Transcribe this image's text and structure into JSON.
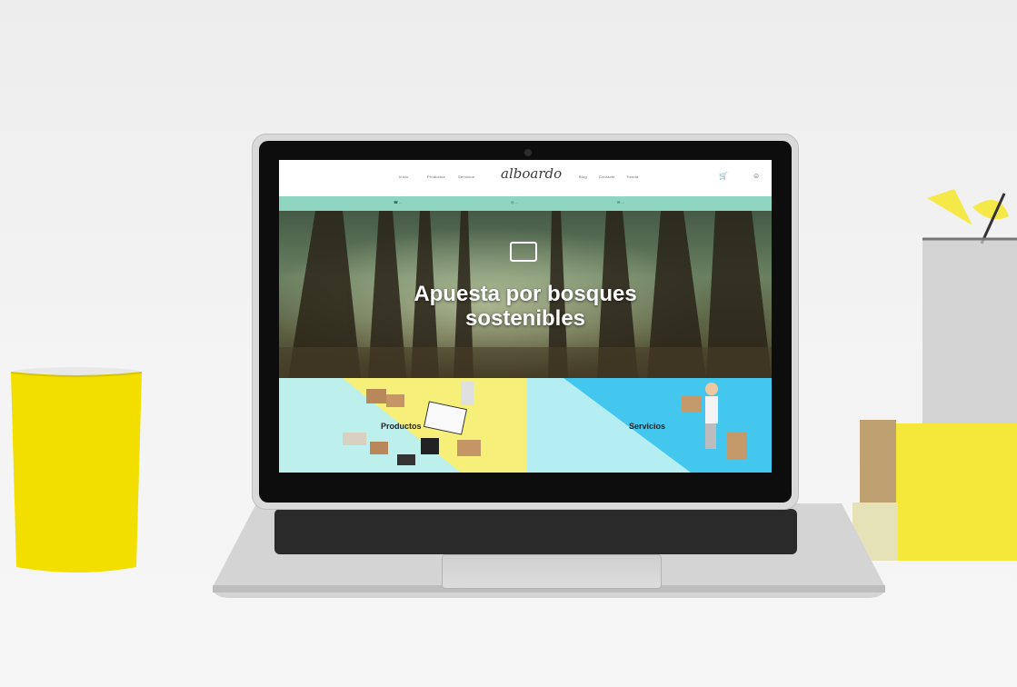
{
  "site": {
    "nav_left": [
      "Inicio",
      "Productos",
      "Servicios"
    ],
    "nav_right": [
      "Blog",
      "Contacto",
      "Tienda"
    ],
    "logo": "alboardo",
    "logo_tagline": "",
    "contacts": [
      "...",
      "...",
      "..."
    ],
    "hero_title_line1": "Apuesta por bosques",
    "hero_title_line2": "sostenibles",
    "tile_left_label": "Productos",
    "tile_right_label": "Servicios"
  },
  "icons": {
    "cart": "cart-icon",
    "user": "user-icon",
    "phone": "phone-icon",
    "mail": "mail-icon"
  },
  "colors": {
    "contact_bar": "#8ed5c2",
    "tile_left": "#f6f07a",
    "tile_right": "#b4eef2",
    "mug": "#f4e300",
    "books": "#f6e83a"
  }
}
